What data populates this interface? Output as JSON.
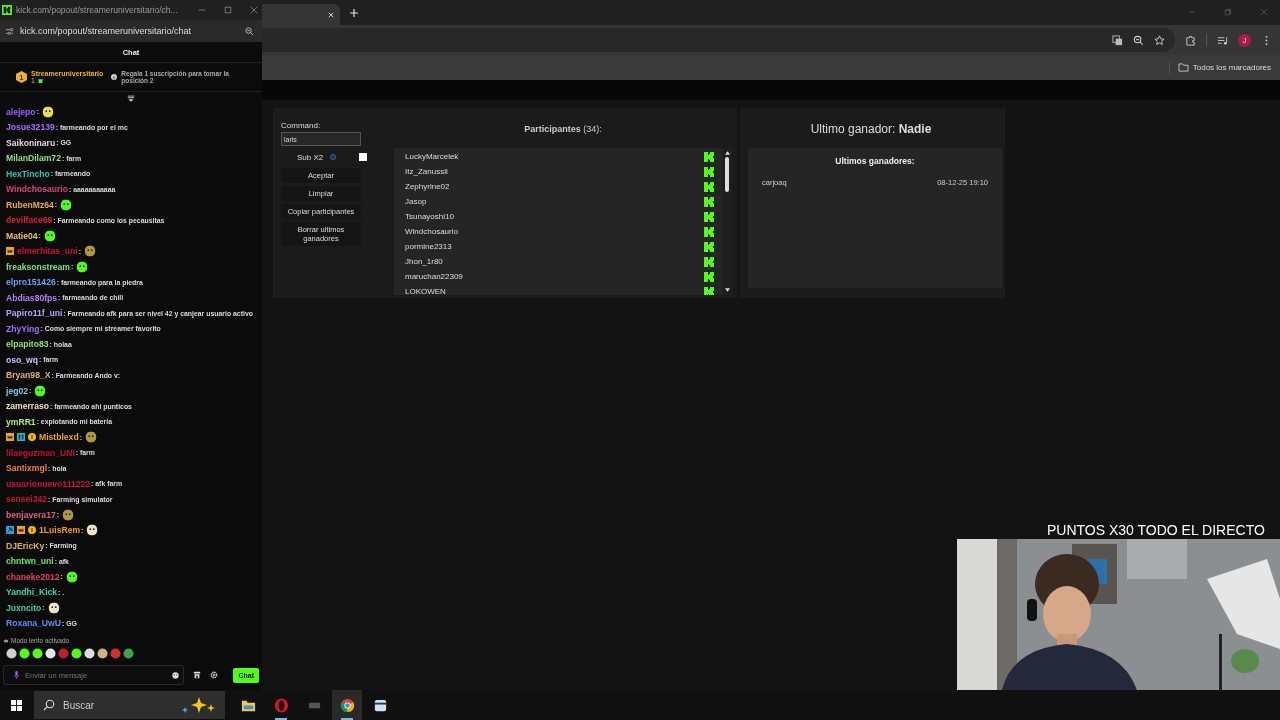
{
  "chat_window": {
    "title": "kick.com/popout/streameruniversitario/ch...",
    "address": "kick.com/popout/streameruniversitario/chat",
    "header": "Chat",
    "leader": {
      "rank": "1",
      "name": "Streameruniversitario",
      "count": "1",
      "note": "Regala 1 suscripción para tomar la posición 2"
    },
    "messages": [
      {
        "user": "alejepo",
        "color": "#9b5cff",
        "text": ":",
        "emote": {
          "kind": "yellow"
        }
      },
      {
        "user": "Josue32139",
        "color": "#a66cff",
        "text": ": farmeando por el mc"
      },
      {
        "user": "Saikoninaru",
        "color": "#e8cfe0",
        "text": ": GG"
      },
      {
        "user": "MilanDilam72",
        "color": "#8be38b",
        "text": ": farm"
      },
      {
        "user": "HexTincho",
        "color": "#2ec4b6",
        "text": ": farmeando"
      },
      {
        "user": "Windchosaurio",
        "color": "#e0407a",
        "text": ": aaaaaaaaaaa"
      },
      {
        "user": "RubenMz64",
        "color": "#f0a850",
        "text": ":",
        "emote": {
          "kind": "green"
        }
      },
      {
        "user": "devilface69",
        "color": "#e01c3c",
        "text": ": Farmeando como los pecausitas"
      },
      {
        "user": "Matie04",
        "color": "#f0c070",
        "text": ":",
        "emote": {
          "kind": "green"
        }
      },
      {
        "user": "elmerhitas_uni",
        "color": "#d0103a",
        "text": ":",
        "emote": {
          "kind": "tan"
        },
        "badges": [
          {
            "kind": "crown"
          }
        ]
      },
      {
        "user": "freaksonstream",
        "color": "#7de07d",
        "text": ":",
        "emote": {
          "kind": "green"
        }
      },
      {
        "user": "elpro151426",
        "color": "#6aa0f0",
        "text": ": farmeando para la piedra"
      },
      {
        "user": "Abdias80fps",
        "color": "#b080f0",
        "text": ": farmeando de chill"
      },
      {
        "user": "Papiro11f_uni",
        "color": "#b4a4ff",
        "text": ": Farmeando afk para ser nivel 42 y canjear usuario activo"
      },
      {
        "user": "ZhyYing",
        "color": "#a070ff",
        "text": ": Como siempre mi streamer favorito"
      },
      {
        "user": "elpapito83",
        "color": "#94e070",
        "text": ": holaa"
      },
      {
        "user": "oso_wq",
        "color": "#c4c4ff",
        "text": ": farm"
      },
      {
        "user": "Bryan98_X",
        "color": "#e0b070",
        "text": ": Farmeando Ando v:"
      },
      {
        "user": "jeg02",
        "color": "#70d0e0",
        "text": ":",
        "emote": {
          "kind": "green"
        }
      },
      {
        "user": "zamerraso",
        "color": "#f0e0c0",
        "text": ": farmeando ahi punticos"
      },
      {
        "user": "ymRR1",
        "color": "#a8f070",
        "text": ": explotando mi bateria"
      },
      {
        "user": "Mistblexd",
        "color": "#f0a020",
        "text": ":",
        "emote": {
          "kind": "tan"
        },
        "badges": [
          {
            "kind": "crown"
          },
          {
            "kind": "sub"
          },
          {
            "kind": "coin"
          }
        ]
      },
      {
        "user": "lilaeguzman_UNI",
        "color": "#c01030",
        "text": ": farm"
      },
      {
        "user": "Santixmgl",
        "color": "#f08040",
        "text": ": hola"
      },
      {
        "user": "usuarionuevo111222",
        "color": "#d01040",
        "text": ": afk farm"
      },
      {
        "user": "sensei342",
        "color": "#d01030",
        "text": ": Farming simulator"
      },
      {
        "user": "benjavera17",
        "color": "#e06080",
        "text": ":",
        "emote": {
          "kind": "tan"
        }
      },
      {
        "user": "1LuisRem",
        "color": "#f0a020",
        "text": ":",
        "emote": {
          "kind": "cream"
        },
        "badges": [
          {
            "kind": "mod"
          },
          {
            "kind": "crown"
          },
          {
            "kind": "coin"
          }
        ]
      },
      {
        "user": "DJEricKy",
        "color": "#e0b060",
        "text": ": Farming"
      },
      {
        "user": "chntwn_uni",
        "color": "#70e070",
        "text": ": afk"
      },
      {
        "user": "chaneke2012",
        "color": "#e04060",
        "text": ":",
        "emote": {
          "kind": "green"
        }
      },
      {
        "user": "Yandhi_Kick",
        "color": "#40d0b0",
        "text": ": ."
      },
      {
        "user": "Juxncito",
        "color": "#40d0a0",
        "text": ":",
        "emote": {
          "kind": "cream"
        }
      },
      {
        "user": "Roxana_UwU",
        "color": "#6090f0",
        "text": ": GG"
      }
    ],
    "slow_mode": "Modo lento activado",
    "emote_bar": [
      {
        "color": "#cfcfcf"
      },
      {
        "color": "#53fc18"
      },
      {
        "color": "#53fc18"
      },
      {
        "color": "#e6e6e6"
      },
      {
        "color": "#c0202a"
      },
      {
        "color": "#53fc18"
      },
      {
        "color": "#dddddd"
      },
      {
        "color": "#c8b878"
      },
      {
        "color": "#d03030"
      },
      {
        "color": "#3fa34d"
      }
    ],
    "input": {
      "placeholder": "Enviar un mensaje"
    },
    "send_button": "Chat"
  },
  "browser": {
    "avatar": "J",
    "bookmarks": "Todos los marcadores"
  },
  "app": {
    "command_label": "Command:",
    "command_value": "laris",
    "sub_x2": {
      "label": "Sub X2",
      "checked": false
    },
    "buttons": [
      "Aceptar",
      "Limpiar",
      "Copiar participantes",
      "Borrar ultimos ganadores"
    ],
    "participants_title": "**Participantes** (34):",
    "participants": [
      "LuckyMarcelek",
      "Itz_Zanussii",
      "Zephyrine02",
      "Jasop",
      "Tsunayoshi10",
      "Windchosaurio",
      "pormine2313",
      "Jhon_1r80",
      "maruchan22309",
      "LOKOWEN"
    ],
    "last_winner": "Ultimo ganador: **Nadie**",
    "winners_title": "Ultimos ganadores:",
    "winners": [
      {
        "name": "carjoaq",
        "time": "08-12-25 19:10"
      }
    ]
  },
  "overlay": {
    "banner": "PUNTOS X30 TODO EL DIRECTO"
  },
  "taskbar": {
    "search_placeholder": "Buscar",
    "apps": [
      {
        "kind": "explorer",
        "running": false,
        "selected": false
      },
      {
        "kind": "opera",
        "running": true,
        "selected": false
      },
      {
        "kind": "app",
        "running": false,
        "selected": false
      },
      {
        "kind": "chrome",
        "running": true,
        "selected": true
      },
      {
        "kind": "box",
        "running": false,
        "selected": false
      }
    ]
  }
}
